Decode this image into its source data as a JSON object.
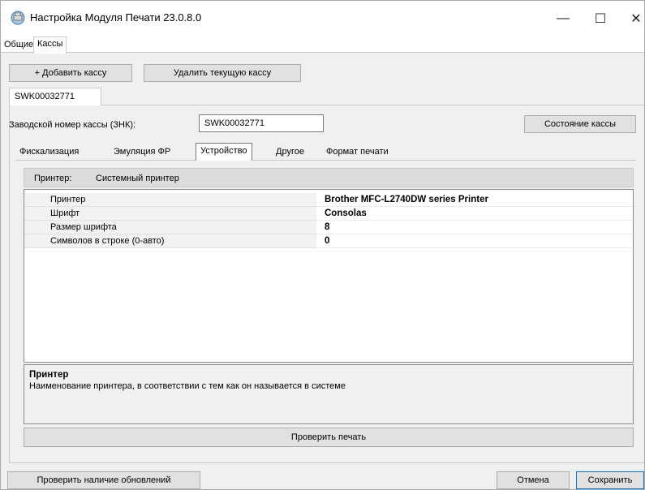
{
  "window": {
    "title": "Настройка Модуля Печати 23.0.8.0",
    "minimize_glyph": "—",
    "maximize_glyph": "☐",
    "close_glyph": "✕"
  },
  "outer_tabs": {
    "general": "Общие",
    "registers": "Кассы"
  },
  "toolbar": {
    "add": "+ Добавить кассу",
    "delete": "Удалить текущую кассу"
  },
  "register_tab": "SWK00032771",
  "factory_number": {
    "label": "Заводской номер кассы (ЗНК):",
    "value": "SWK00032771"
  },
  "state_button": "Состояние кассы",
  "inner_tabs": {
    "fiscal": "Фискализация",
    "emulation": "Эмуляция ФР",
    "device": "Устройство",
    "other": "Другое",
    "print_format": "Формат печати"
  },
  "printer_type": {
    "label": "Принтер:",
    "value": "Системный принтер"
  },
  "properties": [
    {
      "name": "Принтер",
      "value": "Brother MFC-L2740DW series Printer"
    },
    {
      "name": "Шрифт",
      "value": "Consolas"
    },
    {
      "name": "Размер шрифта",
      "value": "8"
    },
    {
      "name": "Символов в строке (0-авто)",
      "value": "0"
    }
  ],
  "description": {
    "title": "Принтер",
    "text": "Наименование принтера, в соответствии с тем как он называется в системе"
  },
  "test_print_button": "Проверить печать",
  "footer": {
    "check_updates": "Проверить наличие обновлений",
    "cancel": "Отмена",
    "save": "Сохранить"
  }
}
